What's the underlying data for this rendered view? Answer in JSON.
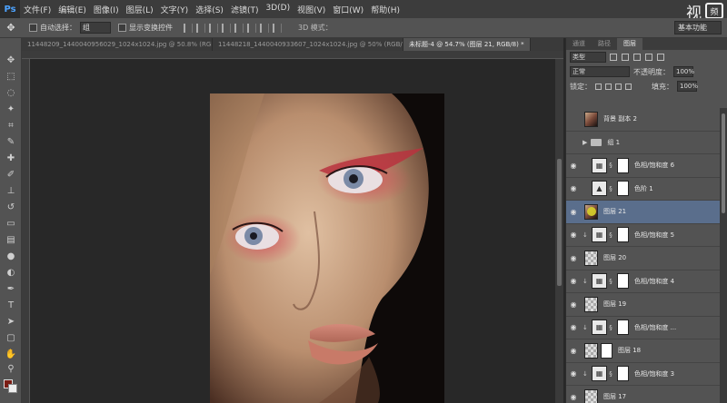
{
  "app": {
    "logo": "Ps"
  },
  "menu": [
    "文件(F)",
    "编辑(E)",
    "图像(I)",
    "图层(L)",
    "文字(Y)",
    "选择(S)",
    "滤镜(T)",
    "3D(D)",
    "视图(V)",
    "窗口(W)",
    "帮助(H)"
  ],
  "watermark": {
    "text": "视",
    "box": "频"
  },
  "options": {
    "auto_select_label": "自动选择：",
    "auto_select_value": "组",
    "show_transform_label": "显示变换控件",
    "mode_label": "3D 模式：",
    "workspace": "基本功能"
  },
  "tabs": [
    {
      "label": "11448209_1440040956029_1024x1024.jpg @ 50.8% (RGB/8...",
      "active": false
    },
    {
      "label": "11448218_1440040933607_1024x1024.jpg @ 50% (RGB/8...",
      "active": false
    },
    {
      "label": "未标题-4 @ 54.7% (图层 21, RGB/8) *",
      "active": true
    }
  ],
  "panel": {
    "tabs": [
      {
        "label": "通道",
        "active": false
      },
      {
        "label": "路径",
        "active": false
      },
      {
        "label": "图层",
        "active": true
      }
    ],
    "filter_kind": "类型",
    "blend_mode": "正常",
    "opacity_label": "不透明度：",
    "opacity_value": "100%",
    "lock_label": "锁定：",
    "fill_label": "填充：",
    "fill_value": "100%"
  },
  "layers": [
    {
      "name": "背景 副本 2",
      "kind": "photo",
      "visible": false,
      "selected": false
    },
    {
      "name": "组 1",
      "kind": "group",
      "visible": false,
      "selected": false
    },
    {
      "name": "色相/饱和度 6",
      "kind": "hue",
      "visible": true,
      "selected": false
    },
    {
      "name": "色阶 1",
      "kind": "levels",
      "visible": true,
      "selected": false
    },
    {
      "name": "图层 21",
      "kind": "photo",
      "visible": true,
      "selected": true
    },
    {
      "name": "色相/饱和度 5",
      "kind": "hue",
      "visible": true,
      "selected": false
    },
    {
      "name": "图层 20",
      "kind": "pixel",
      "visible": true,
      "selected": false
    },
    {
      "name": "色相/饱和度 4",
      "kind": "hue",
      "visible": true,
      "selected": false
    },
    {
      "name": "图层 19",
      "kind": "pixel",
      "visible": true,
      "selected": false
    },
    {
      "name": "色相/饱和度 ...",
      "kind": "hue",
      "visible": true,
      "selected": false
    },
    {
      "name": "图层 18",
      "kind": "pixelmask",
      "visible": true,
      "selected": false
    },
    {
      "name": "色相/饱和度 3",
      "kind": "hue",
      "visible": true,
      "selected": false
    },
    {
      "name": "图层 17",
      "kind": "pixel",
      "visible": true,
      "selected": false
    }
  ],
  "colors": {
    "foreground": "#7b1d14",
    "background": "#eeeeee",
    "selected_layer": "#5a6e8c"
  }
}
